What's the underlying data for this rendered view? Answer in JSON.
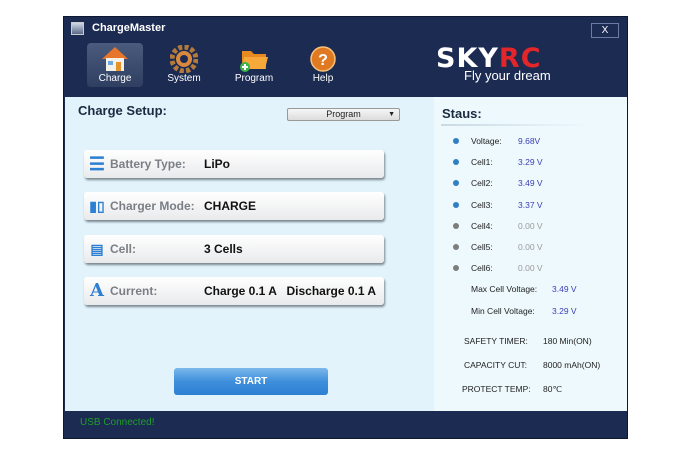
{
  "window": {
    "title": "ChargeMaster",
    "close_label": "X"
  },
  "toolbar": [
    {
      "label": "Charge",
      "icon": "house-icon"
    },
    {
      "label": "System",
      "icon": "gear-icon"
    },
    {
      "label": "Program",
      "icon": "folder-add-icon"
    },
    {
      "label": "Help",
      "icon": "help-icon"
    }
  ],
  "logo": {
    "brand_a": "SKY",
    "brand_b": "RC",
    "tagline": "Fly your dream"
  },
  "setup": {
    "title": "Charge Setup:",
    "dropdown": "Program",
    "rows": [
      {
        "label": "Battery Type:",
        "value": "LiPo"
      },
      {
        "label": "Charger Mode:",
        "value": "CHARGE"
      },
      {
        "label": "Cell:",
        "value": "3 Cells"
      },
      {
        "label": "Current:",
        "value": "Charge 0.1 A   Discharge 0.1 A"
      }
    ],
    "start": "START"
  },
  "status": {
    "title": "Staus:",
    "items": [
      {
        "label": "Voltage:",
        "value": "9.68V",
        "active": true
      },
      {
        "label": "Cell1:",
        "value": "3.29 V",
        "active": true
      },
      {
        "label": "Cell2:",
        "value": "3.49 V",
        "active": true
      },
      {
        "label": "Cell3:",
        "value": "3.37 V",
        "active": true
      },
      {
        "label": "Cell4:",
        "value": "0.00 V",
        "active": false
      },
      {
        "label": "Cell5:",
        "value": "0.00 V",
        "active": false
      },
      {
        "label": "Cell6:",
        "value": "0.00 V",
        "active": false
      }
    ],
    "max_label": "Max Cell Voltage:",
    "max_value": "3.49 V",
    "min_label": "Min Cell Voltage:",
    "min_value": "3.29 V",
    "safety_label": "SAFETY TIMER:",
    "safety_value": "180 Min(ON)",
    "capacity_label": "CAPACITY CUT:",
    "capacity_value": "8000 mAh(ON)",
    "temp_label": "PROTECT TEMP:",
    "temp_value": "80℃"
  },
  "footer": {
    "usb": "USB  Connected!"
  },
  "colors": {
    "frame": "#1b2b52",
    "accent": "#2d7fd3",
    "status_green": "#1f9e2a"
  }
}
